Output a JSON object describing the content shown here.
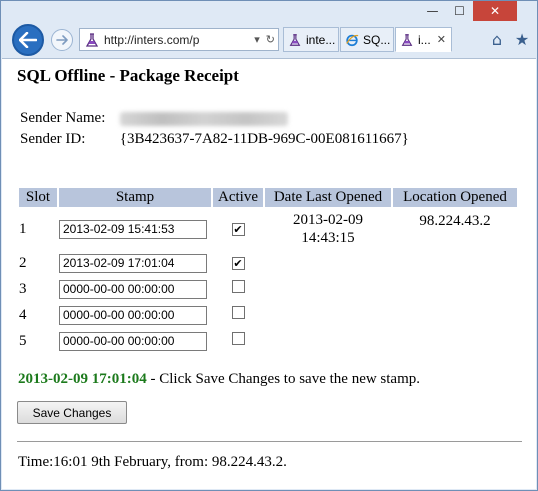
{
  "browser": {
    "window_controls": {
      "minimize": "—",
      "maximize": "☐",
      "close": "✕"
    },
    "back_icon": "back-arrow-icon",
    "forward_icon": "forward-arrow-icon",
    "address": {
      "url": "http://inters.com/p",
      "dropdown": "▾",
      "refresh": "↻"
    },
    "tabs": [
      {
        "label": "inte...",
        "icon": "flask-icon",
        "close": ""
      },
      {
        "label": "SQ...",
        "icon": "ie-icon",
        "close": ""
      },
      {
        "label": "i...",
        "icon": "flask-icon",
        "close": "✕",
        "active": true
      }
    ],
    "home_icon": "⌂",
    "favorites_icon": "★"
  },
  "page": {
    "title": "SQL Offline - Package Receipt",
    "sender_name_label": "Sender Name:",
    "sender_id_label": "Sender ID:",
    "sender_id": "{3B423637-7A82-11DB-969C-00E081611667}",
    "table": {
      "headers": [
        "Slot",
        "Stamp",
        "Active",
        "Date Last Opened",
        "Location Opened"
      ],
      "rows": [
        {
          "slot": "1",
          "stamp": "2013-02-09 15:41:53",
          "active": true,
          "date_line1": "2013-02-09",
          "date_line2": "14:43:15",
          "location": "98.224.43.2"
        },
        {
          "slot": "2",
          "stamp": "2013-02-09 17:01:04",
          "active": true,
          "date_line1": "",
          "date_line2": "",
          "location": ""
        },
        {
          "slot": "3",
          "stamp": "0000-00-00 00:00:00",
          "active": false,
          "date_line1": "",
          "date_line2": "",
          "location": ""
        },
        {
          "slot": "4",
          "stamp": "0000-00-00 00:00:00",
          "active": false,
          "date_line1": "",
          "date_line2": "",
          "location": ""
        },
        {
          "slot": "5",
          "stamp": "0000-00-00 00:00:00",
          "active": false,
          "date_line1": "",
          "date_line2": "",
          "location": ""
        }
      ]
    },
    "message": {
      "stamp": "2013-02-09 17:01:04",
      "text": " - Click Save Changes to save the new stamp."
    },
    "save_button": "Save Changes",
    "footer": "Time:16:01 9th February, from: 98.224.43.2."
  },
  "colors": {
    "accent_green": "#1c7a1c",
    "table_header": "#b8c5dc",
    "back_button": "#2a6fc0",
    "close_button": "#c7453a"
  }
}
